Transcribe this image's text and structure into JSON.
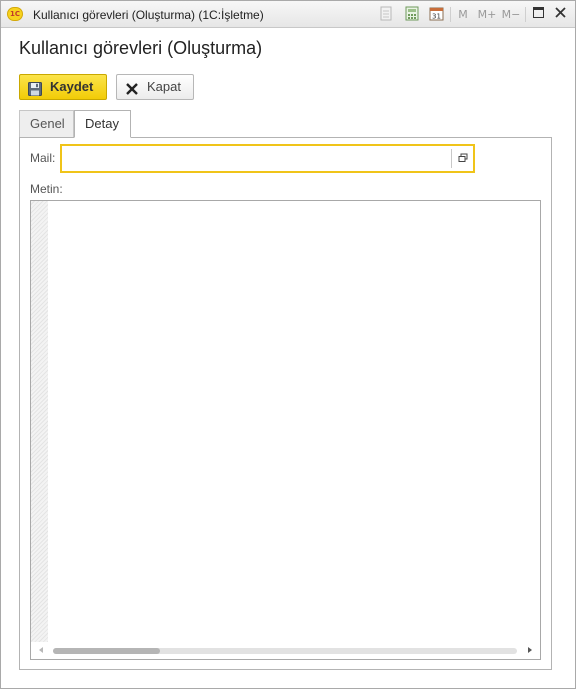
{
  "window": {
    "title": "Kullanıcı görevleri (Oluşturma)  (1C:İşletme)",
    "logo_text": "1C",
    "toolbar": {
      "calendar_day": "31",
      "m_label": "M",
      "m_plus_label": "M+",
      "m_minus_label": "M−",
      "icons": [
        "doc-icon",
        "calculator-icon",
        "calendar-icon",
        "maximize-icon",
        "close-icon"
      ]
    }
  },
  "page": {
    "title": "Kullanıcı görevleri (Oluşturma)"
  },
  "actions": {
    "save_label": "Kaydet",
    "close_label": "Kapat"
  },
  "tabs": [
    {
      "label": "Genel",
      "active": false
    },
    {
      "label": "Detay",
      "active": true
    }
  ],
  "form": {
    "mail_label": "Mail:",
    "mail_value": "",
    "text_label": "Metin:",
    "text_value": "",
    "scroll_position": 0.0,
    "scroll_visible_fraction": 0.23
  },
  "colors": {
    "accent": "#f2cc07",
    "focus_border": "#f0c419"
  }
}
